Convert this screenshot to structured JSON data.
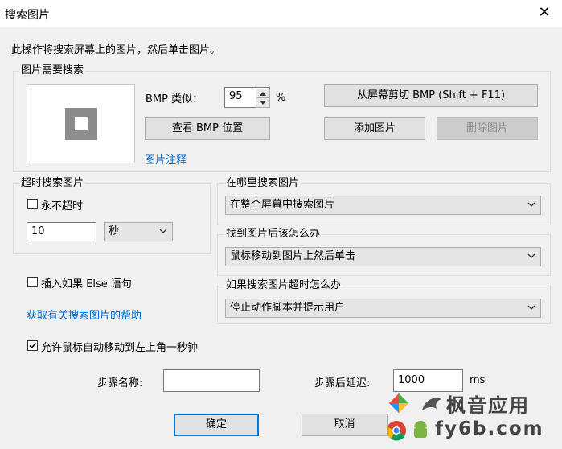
{
  "window": {
    "title": "搜索图片",
    "close_glyph": "✕"
  },
  "instructions": "此操作将搜索屏幕上的图片，然后单击图片。",
  "image_group": {
    "legend": "图片需要搜索",
    "bmp_similar_label": "BMP 类似：",
    "bmp_similar_value": "95",
    "percent": "%",
    "cut_button": "从屏幕剪切 BMP (Shift + F11)",
    "view_button": "查看 BMP 位置",
    "add_button": "添加图片",
    "delete_button": "删除图片",
    "notes_link": "图片注释"
  },
  "timeout_group": {
    "legend": "超时搜索图片",
    "never_timeout_label": "永不超时",
    "never_timeout_checked": false,
    "timeout_value": "10",
    "unit_selected": "秒"
  },
  "where_group": {
    "legend": "在哪里搜索图片",
    "selected": "在整个屏幕中搜索图片"
  },
  "found_group": {
    "legend": "找到图片后该怎么办",
    "selected": "鼠标移动到图片上然后单击"
  },
  "timeout_action_group": {
    "legend": "如果搜索图片超时怎么办",
    "selected": "停止动作脚本并提示用户"
  },
  "insert_else": {
    "label": "插入如果 Else 语句",
    "checked": false
  },
  "help_link": "获取有关搜索图片的帮助",
  "allow_mouse": {
    "label": "允许鼠标自动移动到左上角一秒钟",
    "checked": true
  },
  "step_name": {
    "label": "步骤名称:",
    "value": ""
  },
  "delay": {
    "label": "步骤后延迟:",
    "value": "1000",
    "unit": "ms"
  },
  "buttons": {
    "ok": "确定",
    "cancel": "取消"
  },
  "watermark": {
    "line1": "枫音应用",
    "line2": "fy6b.com"
  }
}
